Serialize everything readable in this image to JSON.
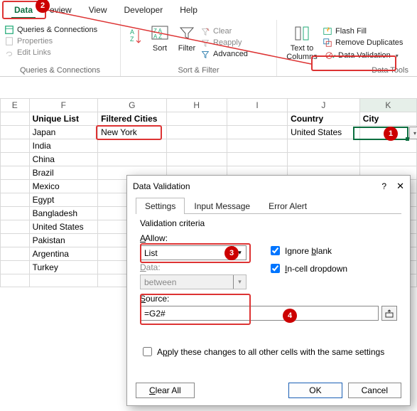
{
  "menu": {
    "data": "Data",
    "review": "eview",
    "view": "View",
    "developer": "Developer",
    "help": "Help"
  },
  "ribbon": {
    "queries_connections": "Queries & Connections",
    "properties": "Properties",
    "edit_links": "Edit Links",
    "group_qc": "Queries & Connections",
    "sort": "Sort",
    "filter": "Filter",
    "clear": "Clear",
    "reapply": "Reapply",
    "advanced": "Advanced",
    "group_sf": "Sort & Filter",
    "text_to_columns": "Text to Columns",
    "flash_fill": "Flash Fill",
    "remove_duplicates": "Remove Duplicates",
    "data_validation": "Data Validation",
    "group_dt": "Data Tools"
  },
  "columns": [
    "E",
    "F",
    "G",
    "H",
    "I",
    "J",
    "K"
  ],
  "headers": {
    "unique": "Unique List",
    "filtered": "Filtered Cities",
    "country": "Country",
    "city": "City"
  },
  "city_value": "New York",
  "country_value": "United States",
  "list": [
    "Japan",
    "India",
    "China",
    "Brazil",
    "Mexico",
    "Egypt",
    "Bangladesh",
    "United States",
    "Pakistan",
    "Argentina",
    "Turkey"
  ],
  "dialog": {
    "title": "Data Validation",
    "tab_settings": "Settings",
    "tab_input": "Input Message",
    "tab_error": "Error Alert",
    "criteria": "Validation criteria",
    "allow": "Allow:",
    "allow_value": "List",
    "data": "Data:",
    "data_value": "between",
    "source": "Source:",
    "source_value": "=G2#",
    "ignore_blank": "Ignore blank",
    "incell": "In-cell dropdown",
    "apply_all": "Apply these changes to all other cells with the same settings",
    "clear_all": "Clear All",
    "ok": "OK",
    "cancel": "Cancel",
    "help": "?",
    "close": "✕"
  },
  "chart_data": {
    "type": "table",
    "title": "Excel Data Validation screenshot",
    "columns": [
      "E",
      "F",
      "G",
      "H",
      "I",
      "J",
      "K"
    ],
    "rows": [
      [
        "",
        "Unique List",
        "Filtered Cities",
        "",
        "",
        "Country",
        "City"
      ],
      [
        "",
        "Japan",
        "New York",
        "",
        "",
        "United States",
        ""
      ],
      [
        "",
        "India",
        "",
        "",
        "",
        "",
        ""
      ],
      [
        "",
        "China",
        "",
        "",
        "",
        "",
        ""
      ],
      [
        "",
        "Brazil",
        "",
        "",
        "",
        "",
        ""
      ],
      [
        "",
        "Mexico",
        "",
        "",
        "",
        "",
        ""
      ],
      [
        "",
        "Egypt",
        "",
        "",
        "",
        "",
        ""
      ],
      [
        "",
        "Bangladesh",
        "",
        "",
        "",
        "",
        ""
      ],
      [
        "",
        "United States",
        "",
        "",
        "",
        "",
        ""
      ],
      [
        "",
        "Pakistan",
        "",
        "",
        "",
        "",
        ""
      ],
      [
        "",
        "Argentina",
        "",
        "",
        "",
        "",
        ""
      ],
      [
        "",
        "Turkey",
        "",
        "",
        "",
        "",
        ""
      ]
    ],
    "dialog_values": {
      "Allow": "List",
      "Data": "between",
      "Source": "=G2#",
      "Ignore blank": true,
      "In-cell dropdown": true
    }
  }
}
